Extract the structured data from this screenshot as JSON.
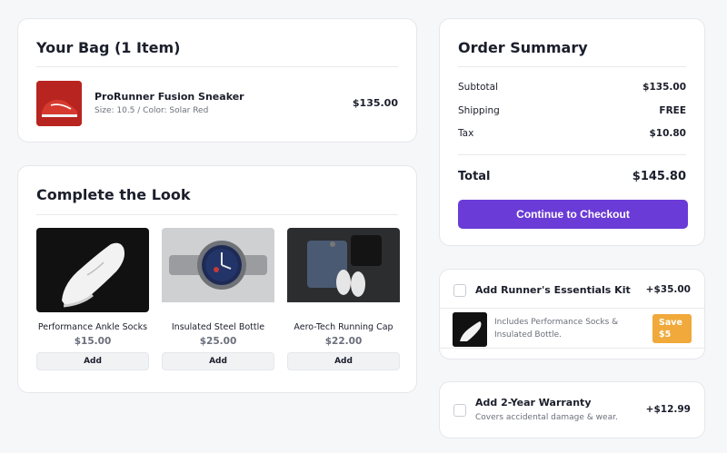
{
  "bag": {
    "title": "Your Bag (1 Item)",
    "item": {
      "name": "ProRunner Fusion Sneaker",
      "meta": "Size: 10.5 / Color: Solar Red",
      "price": "$135.00"
    }
  },
  "look": {
    "title": "Complete the Look",
    "items": [
      {
        "name": "Performance Ankle Socks",
        "price": "$15.00",
        "add_label": "Add",
        "image": "white-sneaker-photo"
      },
      {
        "name": "Insulated Steel Bottle",
        "price": "$25.00",
        "add_label": "Add",
        "image": "wristwatch-photo"
      },
      {
        "name": "Aero-Tech Running Cap",
        "price": "$22.00",
        "add_label": "Add",
        "image": "flatlay-jeans-sneakers-photo"
      }
    ]
  },
  "summary": {
    "title": "Order Summary",
    "rows": [
      {
        "label": "Subtotal",
        "value": "$135.00"
      },
      {
        "label": "Shipping",
        "value": "FREE"
      },
      {
        "label": "Tax",
        "value": "$10.80"
      }
    ],
    "total_label": "Total",
    "total_value": "$145.80",
    "checkout_label": "Continue to Checkout"
  },
  "kit": {
    "title": "Add Runner's Essentials Kit",
    "price": "+$35.00",
    "description_line1": "Includes Performance Socks &",
    "description_line2": "Insulated Bottle.",
    "badge_line1": "Save",
    "badge_line2": "$5"
  },
  "warranty": {
    "title": "Add 2-Year Warranty",
    "price": "+$12.99",
    "subtitle": "Covers accidental damage & wear."
  },
  "colors": {
    "accent": "#6a3bd6",
    "badge": "#f0a93a",
    "product_red": "#b8241f"
  }
}
